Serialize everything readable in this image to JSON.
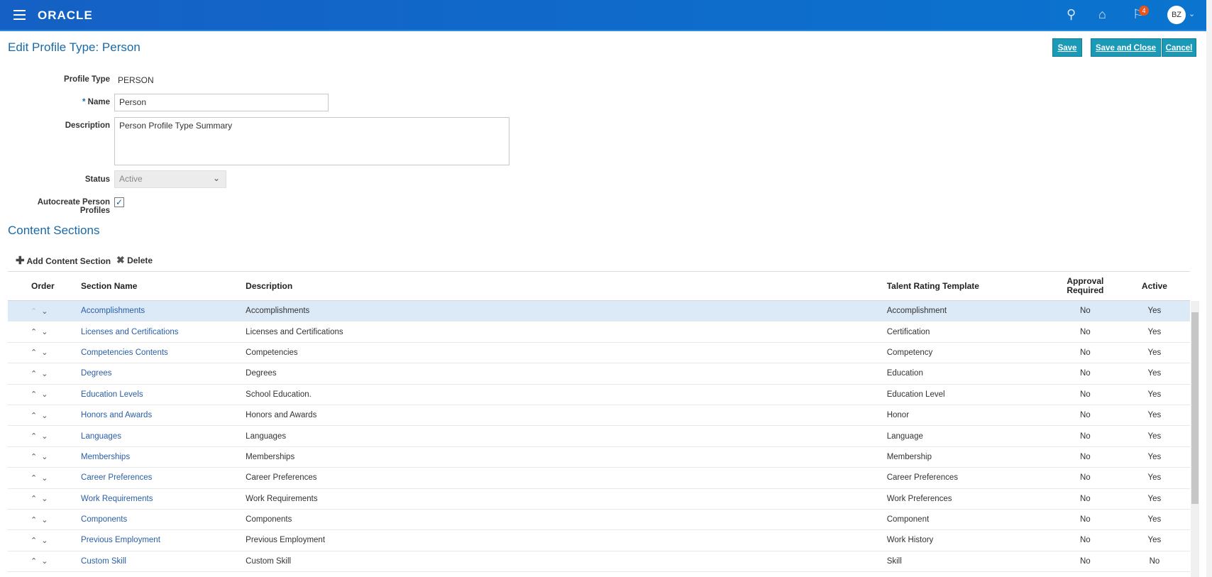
{
  "header": {
    "logo": "ORACLE",
    "notification_count": "4",
    "user_initials": "BZ",
    "accent": "#1560c4"
  },
  "page": {
    "title": "Edit Profile Type: Person",
    "save": "Save",
    "save_close": "Save and Close",
    "cancel": "Cancel"
  },
  "form": {
    "profile_type_label": "Profile Type",
    "profile_type_value": "PERSON",
    "name_label": "Name",
    "name_value": "Person",
    "description_label": "Description",
    "description_value": "Person Profile Type Summary",
    "status_label": "Status",
    "status_value": "Active",
    "autocreate_label": "Autocreate Person Profiles",
    "autocreate_checked": true
  },
  "content": {
    "title": "Content Sections",
    "add": "Add Content Section",
    "delete": "Delete",
    "columns": [
      "Order",
      "Section Name",
      "Description",
      "Talent Rating Template",
      "Approval Required",
      "Active"
    ],
    "rows": [
      [
        "Accomplishments",
        "Accomplishments",
        "Accomplishment",
        "No",
        "Yes"
      ],
      [
        "Licenses and Certifications",
        "Licenses and Certifications",
        "Certification",
        "No",
        "Yes"
      ],
      [
        "Competencies Contents",
        "Competencies",
        "Competency",
        "No",
        "Yes"
      ],
      [
        "Degrees",
        "Degrees",
        "Education",
        "No",
        "Yes"
      ],
      [
        "Education Levels",
        "School Education.",
        "Education Level",
        "No",
        "Yes"
      ],
      [
        "Honors and Awards",
        "Honors and Awards",
        "Honor",
        "No",
        "Yes"
      ],
      [
        "Languages",
        "Languages",
        "Language",
        "No",
        "Yes"
      ],
      [
        "Memberships",
        "Memberships",
        "Membership",
        "No",
        "Yes"
      ],
      [
        "Career Preferences",
        "Career Preferences",
        "Career Preferences",
        "No",
        "Yes"
      ],
      [
        "Work Requirements",
        "Work Requirements",
        "Work Preferences",
        "No",
        "Yes"
      ],
      [
        "Components",
        "Components",
        "Component",
        "No",
        "Yes"
      ],
      [
        "Previous Employment",
        "Previous Employment",
        "Work History",
        "No",
        "Yes"
      ],
      [
        "Custom Skill",
        "Custom Skill",
        "Skill",
        "No",
        "No"
      ]
    ]
  }
}
